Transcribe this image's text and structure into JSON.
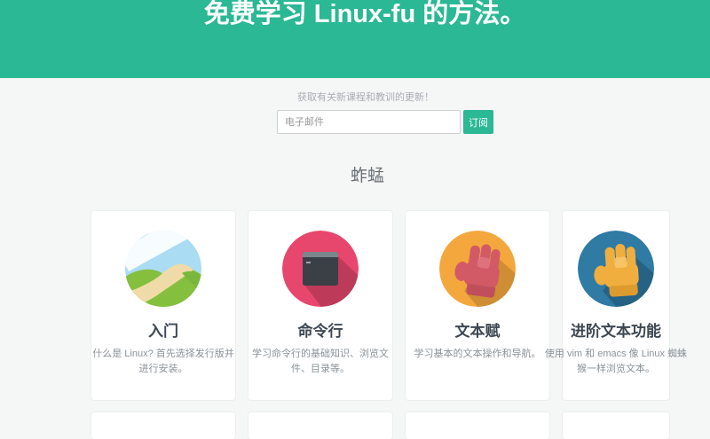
{
  "theme": {
    "accent": "#2bb894",
    "banner_bg": "#2bb894",
    "page_bg": "#f5f6f6",
    "card_bg": "#ffffff"
  },
  "hero": {
    "title": "免费学习 Linux-fu 的方法。"
  },
  "subscribe": {
    "prompt": "获取有关新课程和教训的更新！",
    "email_placeholder": "电子邮件",
    "button_label": "订阅"
  },
  "section": {
    "title": "蚱蜢"
  },
  "cards": [
    {
      "title": "入门",
      "description": "什么是 Linux? 首先选择发行版并进行安装。",
      "icon": "landscape-icon",
      "icon_bg": "#aadcf3"
    },
    {
      "title": "命令行",
      "description": "学习命令行的基础知识、浏览文件、目录等。",
      "icon": "terminal-icon",
      "icon_bg": "#e8476d"
    },
    {
      "title": "文本赋",
      "description": "学习基本的文本操作和导航。",
      "icon": "fist-icon",
      "icon_bg": "#f4a73c"
    },
    {
      "title": "进阶文本功能",
      "description": "使用 vim 和 emacs 像 Linux 蜘蛛猴一样浏览文本。",
      "icon": "hand-icon",
      "icon_bg": "#2f7ba4"
    }
  ]
}
